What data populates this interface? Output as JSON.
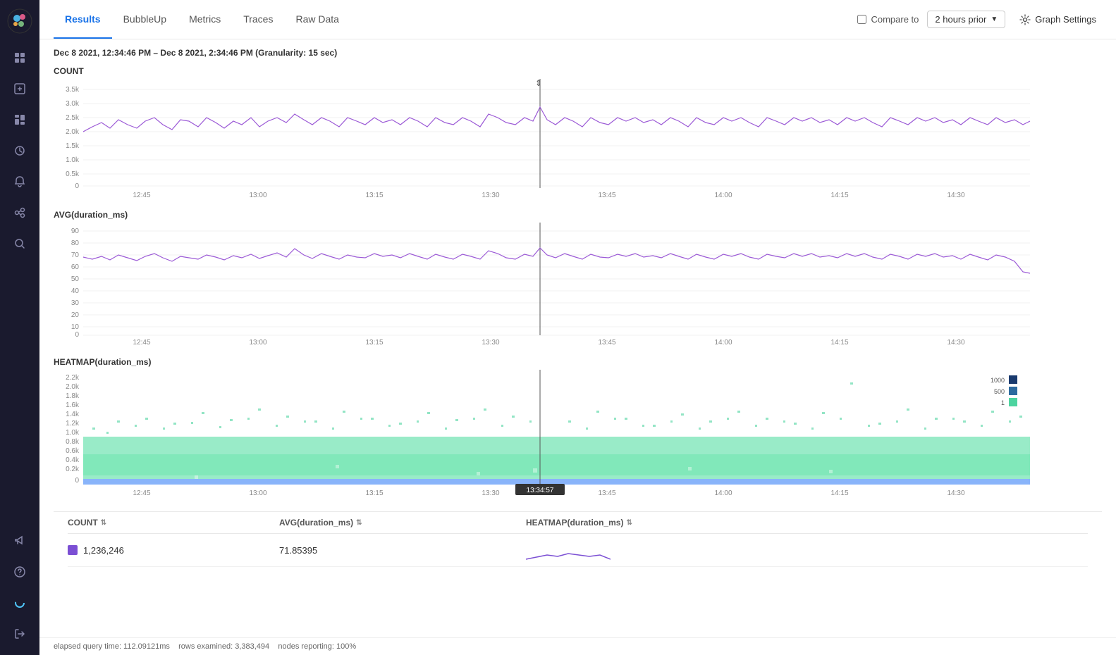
{
  "sidebar": {
    "logo_color": "#4fc3f7",
    "items": [
      {
        "id": "home",
        "icon": "⊞",
        "active": false
      },
      {
        "id": "grid",
        "icon": "▦",
        "active": false
      },
      {
        "id": "history",
        "icon": "↺",
        "active": false
      },
      {
        "id": "bell",
        "icon": "🔔",
        "active": false
      },
      {
        "id": "link",
        "icon": "⛓",
        "active": false
      },
      {
        "id": "search",
        "icon": "🔍",
        "active": false
      }
    ],
    "bottom_items": [
      {
        "id": "megaphone",
        "icon": "📢"
      },
      {
        "id": "question",
        "icon": "?"
      },
      {
        "id": "spinner",
        "icon": "◌"
      },
      {
        "id": "arrow-out",
        "icon": "→"
      }
    ]
  },
  "nav": {
    "tabs": [
      {
        "label": "Results",
        "active": true
      },
      {
        "label": "BubbleUp",
        "active": false
      },
      {
        "label": "Metrics",
        "active": false
      },
      {
        "label": "Traces",
        "active": false
      },
      {
        "label": "Raw Data",
        "active": false
      }
    ]
  },
  "toolbar": {
    "compare_label": "Compare to",
    "hours_option": "2 hours prior",
    "graph_settings_label": "Graph Settings"
  },
  "time_range": {
    "label": "Dec 8 2021, 12:34:46 PM – Dec 8 2021, 2:34:46 PM (Granularity: 15 sec)"
  },
  "charts": {
    "count": {
      "label": "COUNT",
      "y_ticks": [
        "3.5k",
        "3.0k",
        "2.5k",
        "2.0k",
        "1.5k",
        "1.0k",
        "0.5k",
        "0"
      ],
      "x_ticks": [
        "12:45",
        "13:00",
        "13:15",
        "13:30",
        "13:45",
        "14:00",
        "14:15",
        "14:30"
      ]
    },
    "avg": {
      "label": "AVG(duration_ms)",
      "y_ticks": [
        "90",
        "80",
        "70",
        "60",
        "50",
        "40",
        "30",
        "20",
        "10",
        "0"
      ],
      "x_ticks": [
        "12:45",
        "13:00",
        "13:15",
        "13:30",
        "13:45",
        "14:00",
        "14:15",
        "14:30"
      ]
    },
    "heatmap": {
      "label": "HEATMAP(duration_ms)",
      "y_ticks": [
        "2.2k",
        "2.0k",
        "1.8k",
        "1.6k",
        "1.4k",
        "1.2k",
        "1.0k",
        "0.8k",
        "0.6k",
        "0.4k",
        "0.2k",
        "0"
      ],
      "x_ticks": [
        "12:45",
        "13:00",
        "13:15",
        "13:30",
        "13:45",
        "14:00",
        "14:15",
        "14:30"
      ],
      "legend": [
        "1000",
        "500",
        "1"
      ],
      "cursor_time": "13:34:57"
    }
  },
  "table": {
    "columns": [
      "COUNT",
      "AVG(duration_ms)",
      "HEATMAP(duration_ms)"
    ],
    "row": {
      "count_value": "1,236,246",
      "avg_value": "71.85395",
      "heatmap_value": ""
    }
  },
  "footer": {
    "elapsed": "elapsed query time: 112.09121ms",
    "rows_examined": "rows examined: 3,383,494",
    "nodes_reporting": "nodes reporting: 100%"
  }
}
